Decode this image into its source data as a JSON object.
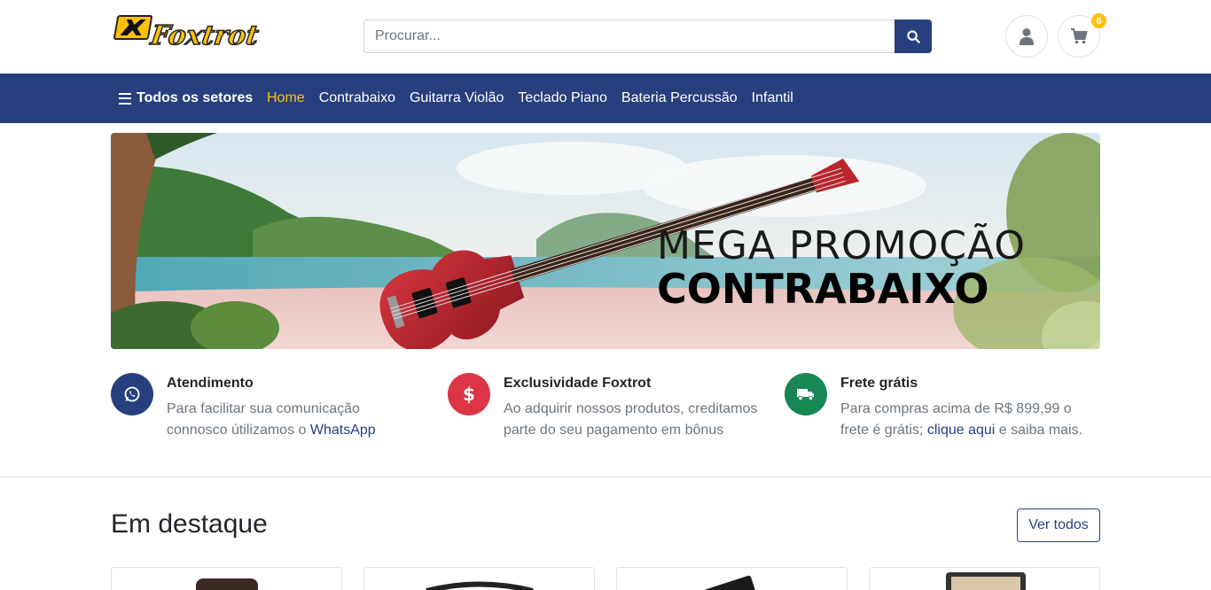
{
  "header": {
    "logo_text": "Foxtrot",
    "search_placeholder": "Procurar...",
    "cart_count": "6"
  },
  "nav": {
    "all_label": "Todos os setores",
    "links": [
      "Home",
      "Contrabaixo",
      "Guitarra Violão",
      "Teclado Piano",
      "Bateria Percussão",
      "Infantil"
    ],
    "active": "Home"
  },
  "banner": {
    "line1": "MEGA PROMOÇÃO",
    "line2": "CONTRABAIXO"
  },
  "features": [
    {
      "icon": "whatsapp-icon",
      "title": "Atendimento",
      "text_before": "Para facilitar sua comunicação connosco útilizamos o ",
      "link": "WhatsApp",
      "text_after": "",
      "color": "#27407d"
    },
    {
      "icon": "dollar-icon",
      "title": "Exclusividade Foxtrot",
      "text_before": "Ao adquirir nossos produtos, creditamos parte do seu pagamento em bônus",
      "link": "",
      "text_after": "",
      "color": "#dc3545"
    },
    {
      "icon": "truck-icon",
      "title": "Frete grátis",
      "text_before": "Para compras acima de R$ 899,99 o frete é grátis; ",
      "link": "clique aqui",
      "text_after": " e saiba mais.",
      "color": "#198754"
    }
  ],
  "featured": {
    "title": "Em destaque",
    "see_all": "Ver todos"
  },
  "colors": {
    "primary": "#27407d",
    "accent": "#ffc107",
    "muted": "#6c757d"
  }
}
